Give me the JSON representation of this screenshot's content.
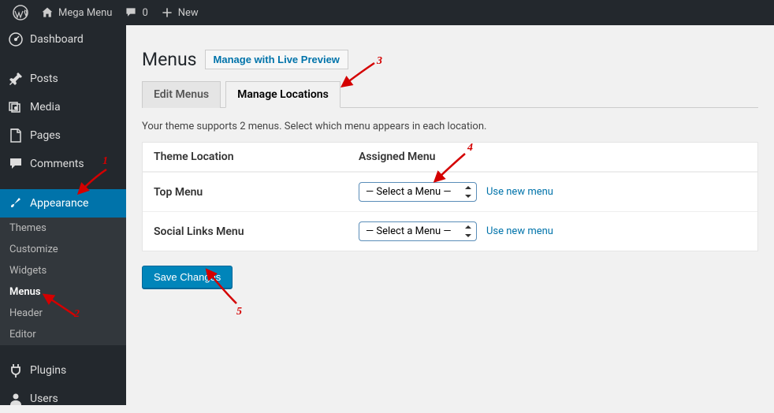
{
  "toolbar": {
    "site_name": "Mega Menu",
    "comments_count": "0",
    "new_label": "New"
  },
  "sidebar": {
    "items": [
      {
        "label": "Dashboard",
        "icon": "dashboard"
      },
      {
        "label": "Posts",
        "icon": "pin"
      },
      {
        "label": "Media",
        "icon": "media"
      },
      {
        "label": "Pages",
        "icon": "page"
      },
      {
        "label": "Comments",
        "icon": "comment"
      },
      {
        "label": "Appearance",
        "icon": "brush",
        "current": true
      },
      {
        "label": "Plugins",
        "icon": "plug"
      },
      {
        "label": "Users",
        "icon": "user"
      }
    ],
    "appearance_sub": [
      {
        "label": "Themes"
      },
      {
        "label": "Customize"
      },
      {
        "label": "Widgets"
      },
      {
        "label": "Menus",
        "active": true
      },
      {
        "label": "Header"
      },
      {
        "label": "Editor"
      }
    ]
  },
  "page": {
    "title": "Menus",
    "title_action": "Manage with Live Preview",
    "tabs": {
      "edit": "Edit Menus",
      "locations": "Manage Locations"
    },
    "instruction": "Your theme supports 2 menus. Select which menu appears in each location.",
    "table": {
      "col_location": "Theme Location",
      "col_menu": "Assigned Menu",
      "rows": [
        {
          "location": "Top Menu",
          "select": "— Select a Menu —",
          "use_new": "Use new menu"
        },
        {
          "location": "Social Links Menu",
          "select": "— Select a Menu —",
          "use_new": "Use new menu"
        }
      ]
    },
    "save": "Save Changes"
  },
  "annotations": {
    "n1": "1",
    "n2": "2",
    "n3": "3",
    "n4": "4",
    "n5": "5"
  }
}
